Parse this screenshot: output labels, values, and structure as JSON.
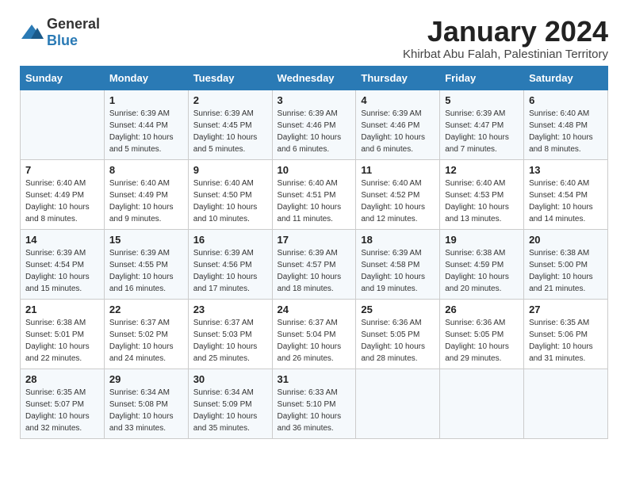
{
  "logo": {
    "general": "General",
    "blue": "Blue"
  },
  "title": "January 2024",
  "subtitle": "Khirbat Abu Falah, Palestinian Territory",
  "days_of_week": [
    "Sunday",
    "Monday",
    "Tuesday",
    "Wednesday",
    "Thursday",
    "Friday",
    "Saturday"
  ],
  "weeks": [
    [
      {
        "day": "",
        "info": ""
      },
      {
        "day": "1",
        "info": "Sunrise: 6:39 AM\nSunset: 4:44 PM\nDaylight: 10 hours\nand 5 minutes."
      },
      {
        "day": "2",
        "info": "Sunrise: 6:39 AM\nSunset: 4:45 PM\nDaylight: 10 hours\nand 5 minutes."
      },
      {
        "day": "3",
        "info": "Sunrise: 6:39 AM\nSunset: 4:46 PM\nDaylight: 10 hours\nand 6 minutes."
      },
      {
        "day": "4",
        "info": "Sunrise: 6:39 AM\nSunset: 4:46 PM\nDaylight: 10 hours\nand 6 minutes."
      },
      {
        "day": "5",
        "info": "Sunrise: 6:39 AM\nSunset: 4:47 PM\nDaylight: 10 hours\nand 7 minutes."
      },
      {
        "day": "6",
        "info": "Sunrise: 6:40 AM\nSunset: 4:48 PM\nDaylight: 10 hours\nand 8 minutes."
      }
    ],
    [
      {
        "day": "7",
        "info": "Sunrise: 6:40 AM\nSunset: 4:49 PM\nDaylight: 10 hours\nand 8 minutes."
      },
      {
        "day": "8",
        "info": "Sunrise: 6:40 AM\nSunset: 4:49 PM\nDaylight: 10 hours\nand 9 minutes."
      },
      {
        "day": "9",
        "info": "Sunrise: 6:40 AM\nSunset: 4:50 PM\nDaylight: 10 hours\nand 10 minutes."
      },
      {
        "day": "10",
        "info": "Sunrise: 6:40 AM\nSunset: 4:51 PM\nDaylight: 10 hours\nand 11 minutes."
      },
      {
        "day": "11",
        "info": "Sunrise: 6:40 AM\nSunset: 4:52 PM\nDaylight: 10 hours\nand 12 minutes."
      },
      {
        "day": "12",
        "info": "Sunrise: 6:40 AM\nSunset: 4:53 PM\nDaylight: 10 hours\nand 13 minutes."
      },
      {
        "day": "13",
        "info": "Sunrise: 6:40 AM\nSunset: 4:54 PM\nDaylight: 10 hours\nand 14 minutes."
      }
    ],
    [
      {
        "day": "14",
        "info": "Sunrise: 6:39 AM\nSunset: 4:54 PM\nDaylight: 10 hours\nand 15 minutes."
      },
      {
        "day": "15",
        "info": "Sunrise: 6:39 AM\nSunset: 4:55 PM\nDaylight: 10 hours\nand 16 minutes."
      },
      {
        "day": "16",
        "info": "Sunrise: 6:39 AM\nSunset: 4:56 PM\nDaylight: 10 hours\nand 17 minutes."
      },
      {
        "day": "17",
        "info": "Sunrise: 6:39 AM\nSunset: 4:57 PM\nDaylight: 10 hours\nand 18 minutes."
      },
      {
        "day": "18",
        "info": "Sunrise: 6:39 AM\nSunset: 4:58 PM\nDaylight: 10 hours\nand 19 minutes."
      },
      {
        "day": "19",
        "info": "Sunrise: 6:38 AM\nSunset: 4:59 PM\nDaylight: 10 hours\nand 20 minutes."
      },
      {
        "day": "20",
        "info": "Sunrise: 6:38 AM\nSunset: 5:00 PM\nDaylight: 10 hours\nand 21 minutes."
      }
    ],
    [
      {
        "day": "21",
        "info": "Sunrise: 6:38 AM\nSunset: 5:01 PM\nDaylight: 10 hours\nand 22 minutes."
      },
      {
        "day": "22",
        "info": "Sunrise: 6:37 AM\nSunset: 5:02 PM\nDaylight: 10 hours\nand 24 minutes."
      },
      {
        "day": "23",
        "info": "Sunrise: 6:37 AM\nSunset: 5:03 PM\nDaylight: 10 hours\nand 25 minutes."
      },
      {
        "day": "24",
        "info": "Sunrise: 6:37 AM\nSunset: 5:04 PM\nDaylight: 10 hours\nand 26 minutes."
      },
      {
        "day": "25",
        "info": "Sunrise: 6:36 AM\nSunset: 5:05 PM\nDaylight: 10 hours\nand 28 minutes."
      },
      {
        "day": "26",
        "info": "Sunrise: 6:36 AM\nSunset: 5:05 PM\nDaylight: 10 hours\nand 29 minutes."
      },
      {
        "day": "27",
        "info": "Sunrise: 6:35 AM\nSunset: 5:06 PM\nDaylight: 10 hours\nand 31 minutes."
      }
    ],
    [
      {
        "day": "28",
        "info": "Sunrise: 6:35 AM\nSunset: 5:07 PM\nDaylight: 10 hours\nand 32 minutes."
      },
      {
        "day": "29",
        "info": "Sunrise: 6:34 AM\nSunset: 5:08 PM\nDaylight: 10 hours\nand 33 minutes."
      },
      {
        "day": "30",
        "info": "Sunrise: 6:34 AM\nSunset: 5:09 PM\nDaylight: 10 hours\nand 35 minutes."
      },
      {
        "day": "31",
        "info": "Sunrise: 6:33 AM\nSunset: 5:10 PM\nDaylight: 10 hours\nand 36 minutes."
      },
      {
        "day": "",
        "info": ""
      },
      {
        "day": "",
        "info": ""
      },
      {
        "day": "",
        "info": ""
      }
    ]
  ]
}
